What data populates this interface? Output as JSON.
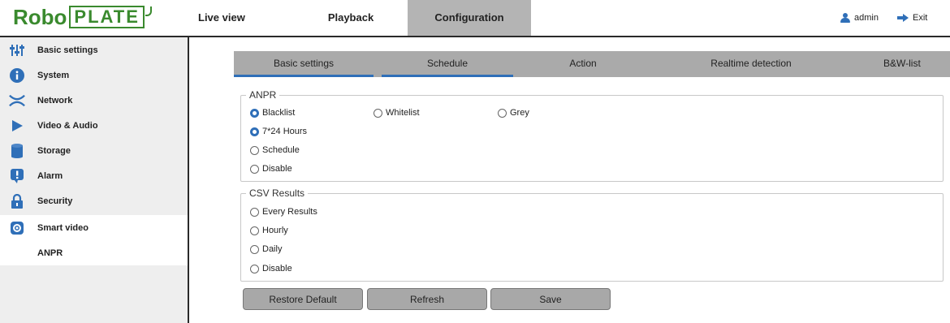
{
  "logo": {
    "text_a": "Robo",
    "text_b": "PLATE",
    "color": "#3a8a2e"
  },
  "nav": {
    "live_view": "Live view",
    "playback": "Playback",
    "configuration": "Configuration"
  },
  "user": {
    "name": "admin",
    "exit": "Exit",
    "icon": "user-icon",
    "exit_icon": "exit-arrow-icon"
  },
  "sidebar": {
    "items": [
      {
        "label": "Basic settings",
        "icon": "sliders-icon"
      },
      {
        "label": "System",
        "icon": "info-icon"
      },
      {
        "label": "Network",
        "icon": "network-icon"
      },
      {
        "label": "Video & Audio",
        "icon": "play-icon"
      },
      {
        "label": "Storage",
        "icon": "database-icon"
      },
      {
        "label": "Alarm",
        "icon": "alarm-icon"
      },
      {
        "label": "Security",
        "icon": "lock-icon"
      },
      {
        "label": "Smart video",
        "icon": "smart-video-icon"
      }
    ],
    "sub_item": "ANPR"
  },
  "tabs": {
    "basic_settings": "Basic settings",
    "schedule": "Schedule",
    "action": "Action",
    "realtime_detection": "Realtime detection",
    "bw_list": "B&W-list"
  },
  "anpr": {
    "legend": "ANPR",
    "blacklist": "Blacklist",
    "whitelist": "Whitelist",
    "grey": "Grey",
    "hours": "7*24 Hours",
    "schedule": "Schedule",
    "disable": "Disable",
    "list_selected": "Blacklist",
    "mode_selected": "7*24 Hours"
  },
  "csv": {
    "legend": "CSV Results",
    "every": "Every Results",
    "hourly": "Hourly",
    "daily": "Daily",
    "disable": "Disable"
  },
  "buttons": {
    "restore": "Restore Default",
    "refresh": "Refresh",
    "save": "Save"
  },
  "colors": {
    "accent": "#2f6fb8",
    "tab_bg": "#aaaaaa",
    "button_bg": "#a8a8a8"
  }
}
